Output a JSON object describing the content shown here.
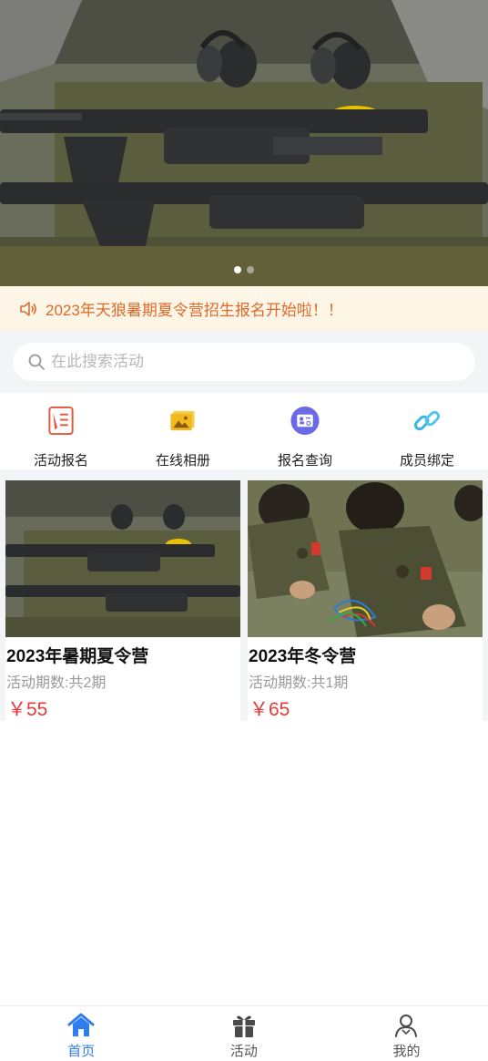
{
  "banner": {
    "image": "field-gear-rifles-photo",
    "slide_count": 2,
    "active_slide": 1
  },
  "notice": {
    "icon": "speaker-icon",
    "text": "2023年天狼暑期夏令营招生报名开始啦！！",
    "color": "#e06a2a"
  },
  "search": {
    "icon": "search-icon",
    "placeholder": "在此搜索活动",
    "value": ""
  },
  "quick_menu": [
    {
      "label": "活动报名",
      "icon": "form-icon",
      "color": "#e5553b"
    },
    {
      "label": "在线相册",
      "icon": "album-icon",
      "color": "#f2b820"
    },
    {
      "label": "报名查询",
      "icon": "id-card-icon",
      "color": "#6a6ae6"
    },
    {
      "label": "成员绑定",
      "icon": "link-icon",
      "color": "#38b4e6"
    }
  ],
  "activities": [
    {
      "title": "2023年暑期夏令营",
      "periods": "活动期数:共2期",
      "price": "￥55",
      "image": "rifles-photo"
    },
    {
      "title": "2023年冬令营",
      "periods": "活动期数:共1期",
      "price": "￥65",
      "image": "children-camo-photo"
    }
  ],
  "tabbar": [
    {
      "label": "首页",
      "icon": "home-icon",
      "active": true
    },
    {
      "label": "活动",
      "icon": "gift-icon",
      "active": false
    },
    {
      "label": "我的",
      "icon": "user-icon",
      "active": false
    }
  ],
  "colors": {
    "accent": "#2f7ef0",
    "price": "#e53a3a",
    "notice_bg": "#fdf6e6"
  }
}
